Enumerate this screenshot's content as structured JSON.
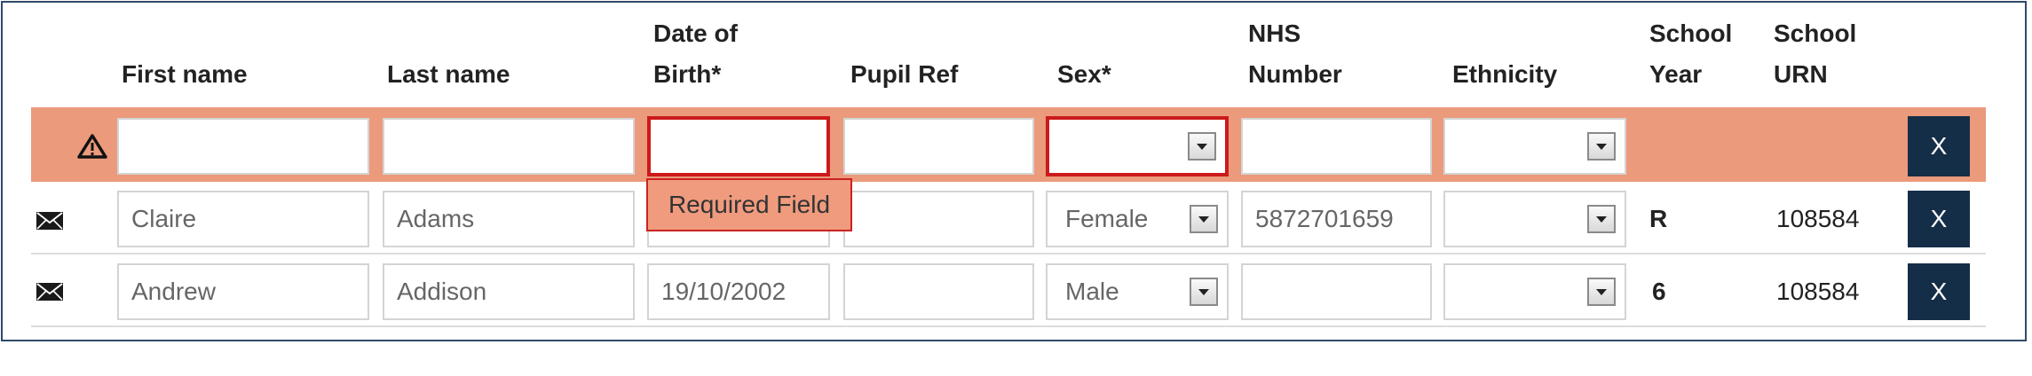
{
  "columns": {
    "first_name": "First name",
    "last_name": "Last name",
    "dob_line1": "Date of",
    "dob_line2": "Birth*",
    "pupil_ref": "Pupil Ref",
    "sex": "Sex*",
    "nhs_line1": "NHS",
    "nhs_line2": "Number",
    "ethnicity": "Ethnicity",
    "year_line1": "School",
    "year_line2": "Year",
    "urn_line1": "School",
    "urn_line2": "URN"
  },
  "new_row": {
    "first_name": "",
    "last_name": "",
    "dob": "",
    "pupil_ref": "",
    "sex": "",
    "nhs_number": "",
    "ethnicity": "",
    "remove_label": "X",
    "error_tooltip": "Required Field"
  },
  "rows": [
    {
      "first_name": "Claire",
      "last_name": "Adams",
      "dob": "",
      "pupil_ref": "",
      "sex": "Female",
      "nhs_number": "5872701659",
      "ethnicity": "",
      "school_year": "R",
      "school_urn": "108584",
      "remove_label": "X"
    },
    {
      "first_name": "Andrew",
      "last_name": "Addison",
      "dob": "19/10/2002",
      "pupil_ref": "",
      "sex": "Male",
      "nhs_number": "",
      "ethnicity": "",
      "school_year": "6",
      "school_urn": "108584",
      "remove_label": "X"
    }
  ],
  "colors": {
    "error_band": "#eb9a7c",
    "error_border": "#cc1a1a",
    "remove_button": "#152e48"
  },
  "icons": {
    "warning": "warning-icon",
    "envelope": "envelope-icon"
  }
}
